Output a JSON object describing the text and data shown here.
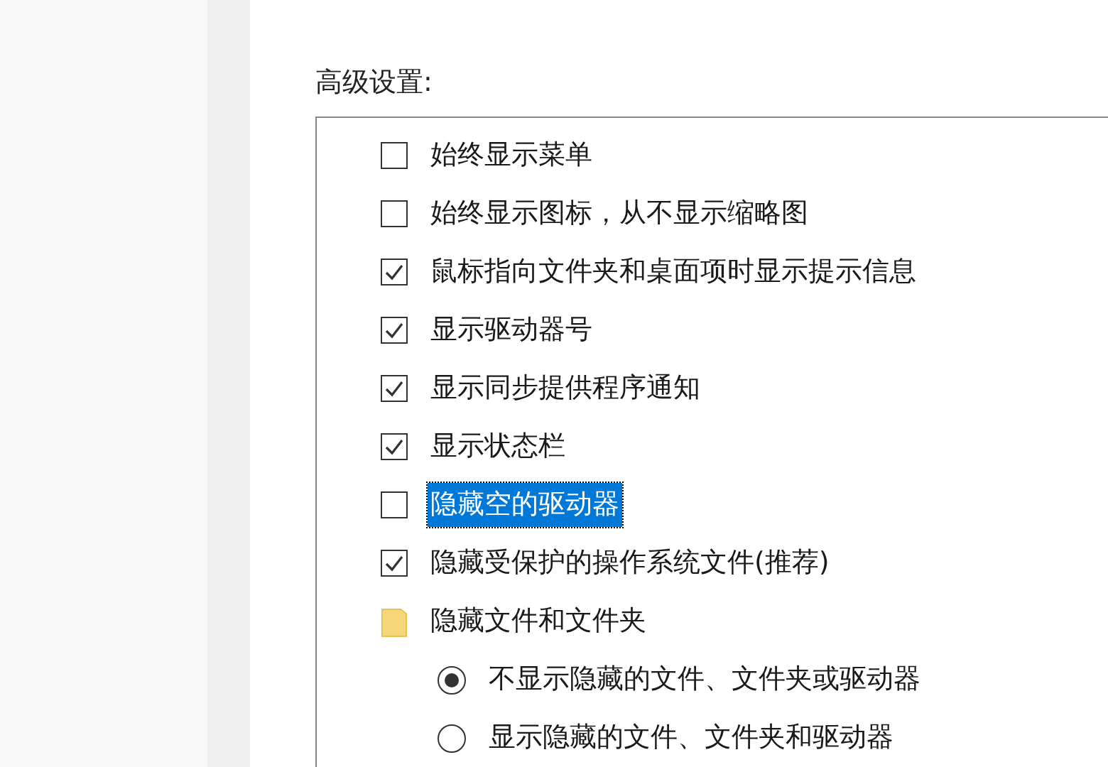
{
  "section_label": "高级设置:",
  "settings": [
    {
      "kind": "checkbox",
      "label": "始终显示菜单",
      "checked": false,
      "selected": false
    },
    {
      "kind": "checkbox",
      "label": "始终显示图标，从不显示缩略图",
      "checked": false,
      "selected": false
    },
    {
      "kind": "checkbox",
      "label": "鼠标指向文件夹和桌面项时显示提示信息",
      "checked": true,
      "selected": false
    },
    {
      "kind": "checkbox",
      "label": "显示驱动器号",
      "checked": true,
      "selected": false
    },
    {
      "kind": "checkbox",
      "label": "显示同步提供程序通知",
      "checked": true,
      "selected": false
    },
    {
      "kind": "checkbox",
      "label": "显示状态栏",
      "checked": true,
      "selected": false
    },
    {
      "kind": "checkbox",
      "label": "隐藏空的驱动器",
      "checked": false,
      "selected": true
    },
    {
      "kind": "checkbox",
      "label": "隐藏受保护的操作系统文件(推荐)",
      "checked": true,
      "selected": false
    },
    {
      "kind": "folder",
      "label": "隐藏文件和文件夹",
      "selected": false,
      "children": [
        {
          "kind": "radio",
          "label": "不显示隐藏的文件、文件夹或驱动器",
          "checked": true,
          "selected": false
        },
        {
          "kind": "radio",
          "label": "显示隐藏的文件、文件夹和驱动器",
          "checked": false,
          "selected": false
        }
      ]
    }
  ]
}
